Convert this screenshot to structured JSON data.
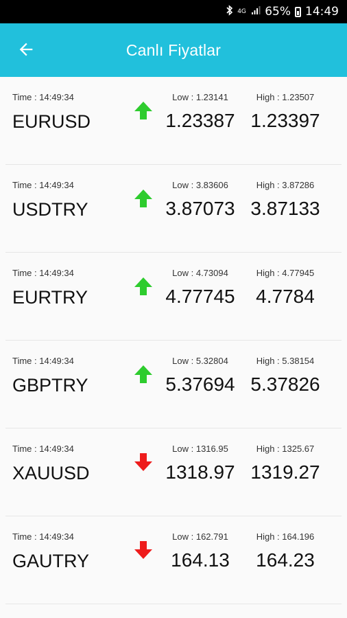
{
  "status_bar": {
    "network": "4G",
    "battery": "65%",
    "time": "14:49",
    "icons": [
      "bluetooth-icon",
      "signal-icon",
      "battery-icon"
    ]
  },
  "app_bar": {
    "title": "Canlı Fiyatlar",
    "back_icon": "arrow-left-icon"
  },
  "colors": {
    "accent": "#21c0dc",
    "up": "#2ecc2e",
    "down": "#ee1c1c"
  },
  "rates": [
    {
      "time": "Time : 14:49:34",
      "symbol": "EURUSD",
      "direction": "up",
      "low_label": "Low : 1.23141",
      "high_label": "High : 1.23507",
      "low_value": "1.23387",
      "high_value": "1.23397"
    },
    {
      "time": "Time : 14:49:34",
      "symbol": "USDTRY",
      "direction": "up",
      "low_label": "Low : 3.83606",
      "high_label": "High : 3.87286",
      "low_value": "3.87073",
      "high_value": "3.87133"
    },
    {
      "time": "Time : 14:49:34",
      "symbol": "EURTRY",
      "direction": "up",
      "low_label": "Low : 4.73094",
      "high_label": "High : 4.77945",
      "low_value": "4.77745",
      "high_value": "4.7784"
    },
    {
      "time": "Time : 14:49:34",
      "symbol": "GBPTRY",
      "direction": "up",
      "low_label": "Low : 5.32804",
      "high_label": "High : 5.38154",
      "low_value": "5.37694",
      "high_value": "5.37826"
    },
    {
      "time": "Time : 14:49:34",
      "symbol": "XAUUSD",
      "direction": "down",
      "low_label": "Low : 1316.95",
      "high_label": "High : 1325.67",
      "low_value": "1318.97",
      "high_value": "1319.27"
    },
    {
      "time": "Time : 14:49:34",
      "symbol": "GAUTRY",
      "direction": "down",
      "low_label": "Low : 162.791",
      "high_label": "High : 164.196",
      "low_value": "164.13",
      "high_value": "164.23"
    }
  ]
}
